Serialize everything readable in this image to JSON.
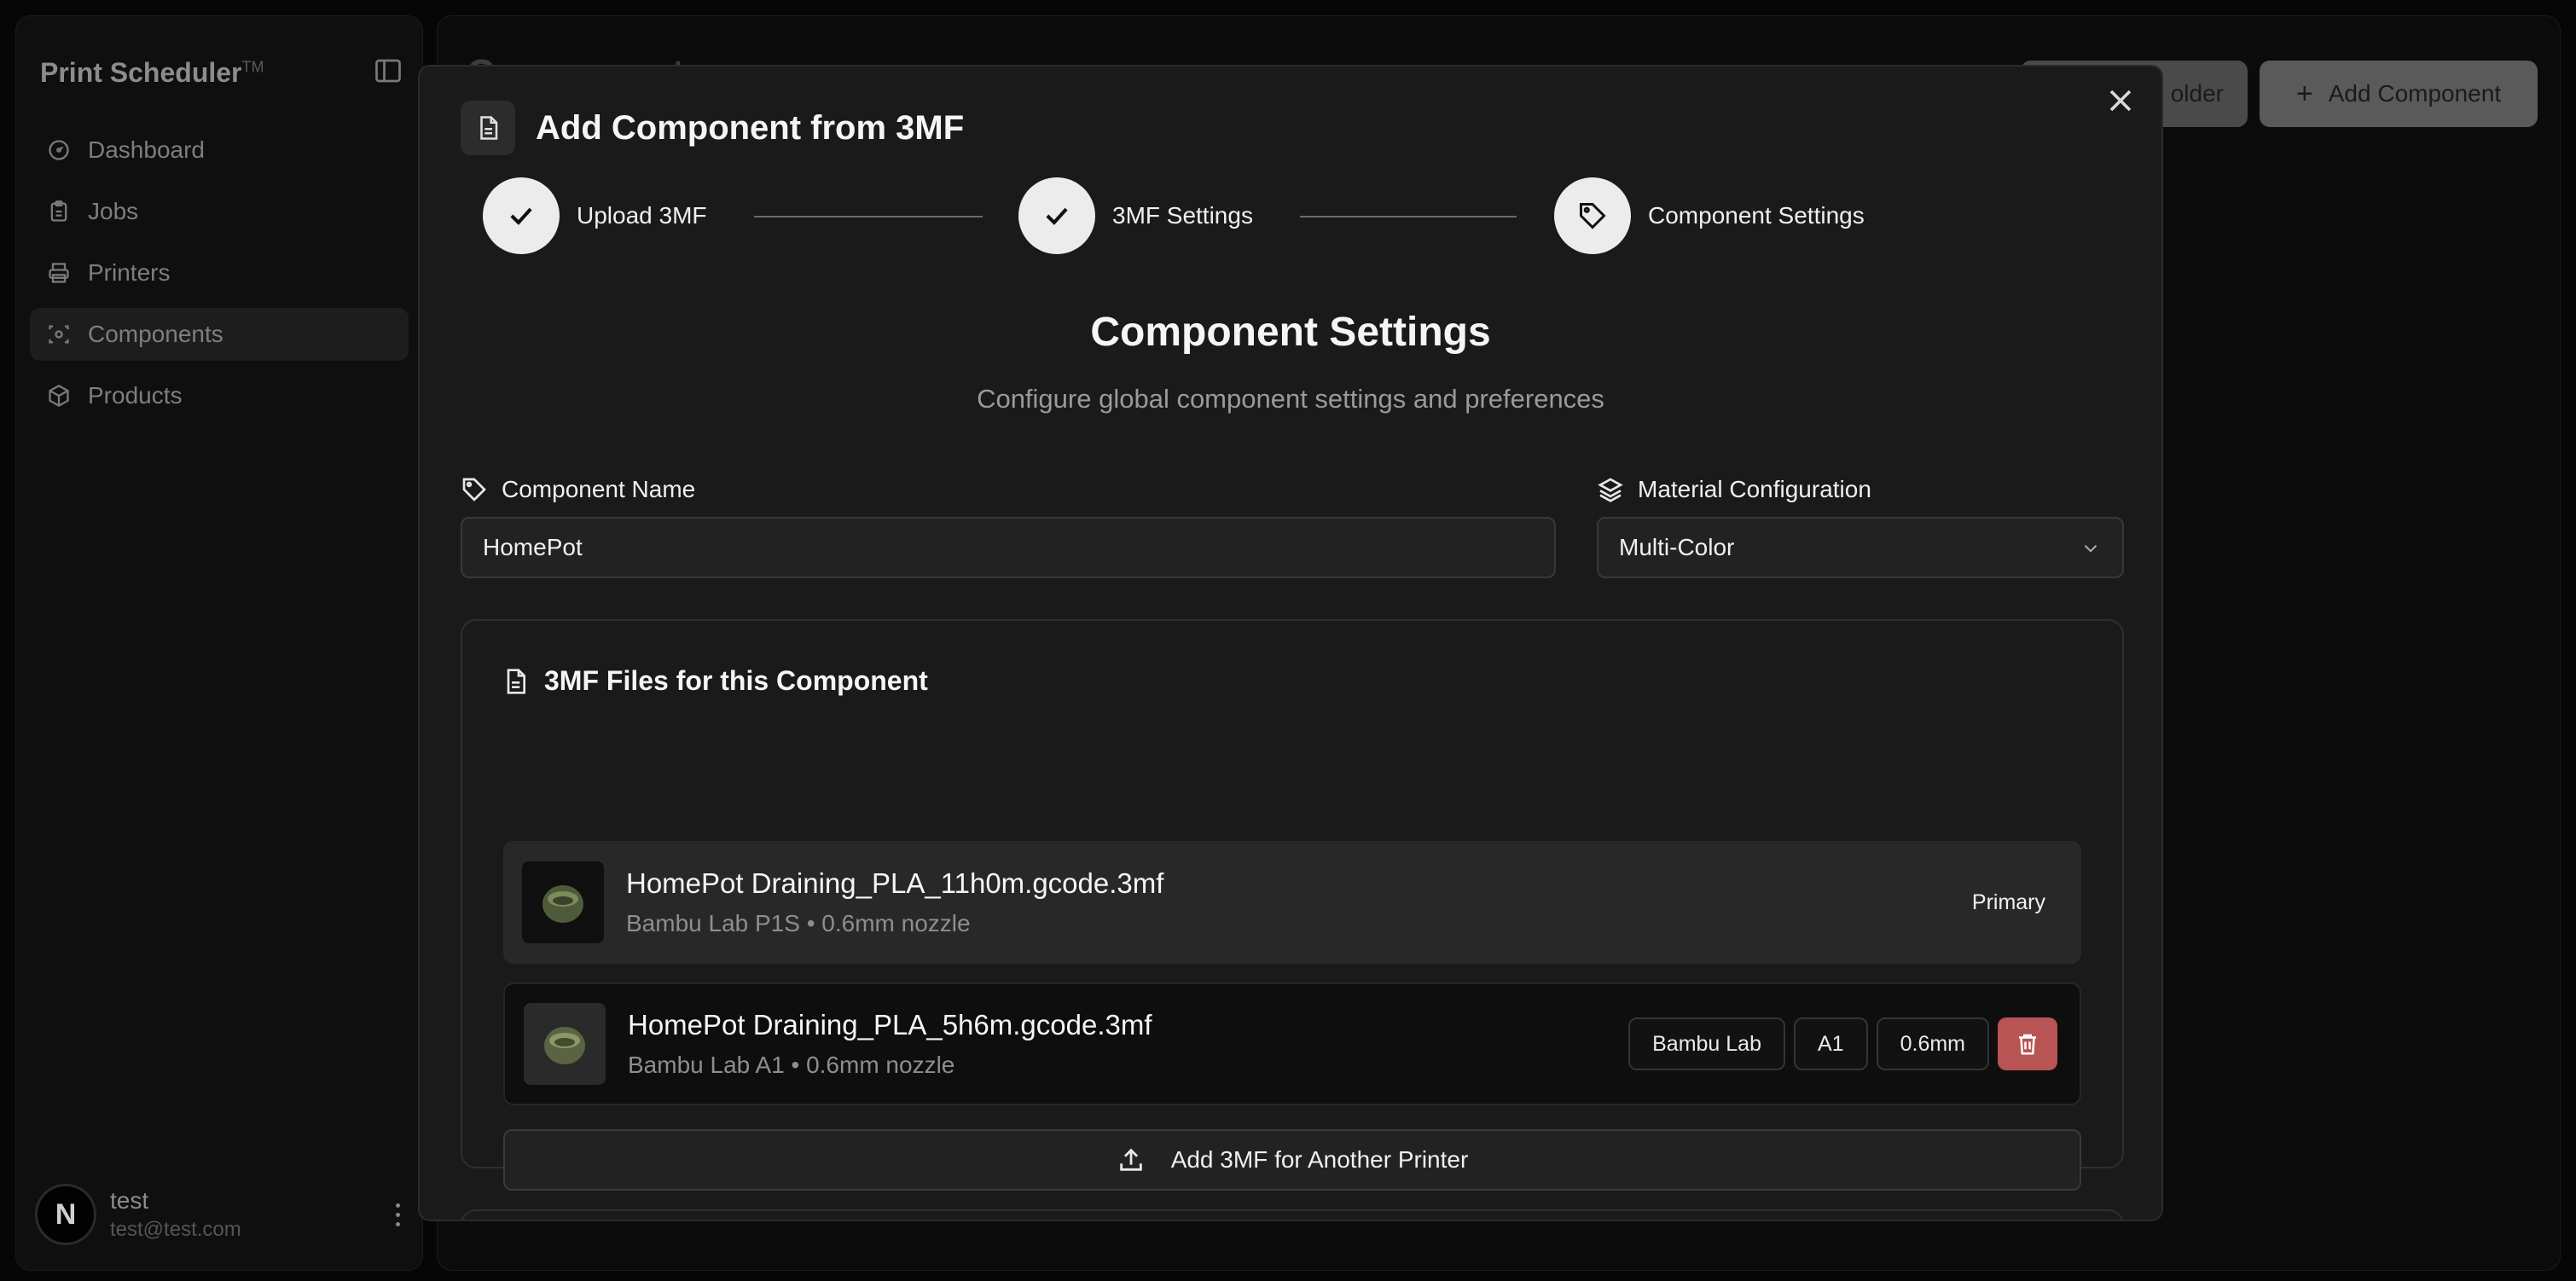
{
  "sidebar": {
    "brand": "Print Scheduler",
    "brand_mark": "TM",
    "nav": [
      {
        "label": "Dashboard",
        "icon": "dashboard-icon"
      },
      {
        "label": "Jobs",
        "icon": "clipboard-icon"
      },
      {
        "label": "Printers",
        "icon": "printer-icon"
      },
      {
        "label": "Components",
        "icon": "component-icon",
        "active": true
      },
      {
        "label": "Products",
        "icon": "package-icon"
      }
    ],
    "user": {
      "initial": "N",
      "name": "test",
      "email": "test@test.com"
    }
  },
  "main": {
    "title": "Components",
    "folder_button": "older",
    "add_button": "Add Component"
  },
  "modal": {
    "title": "Add Component from 3MF",
    "steps": [
      {
        "label": "Upload 3MF",
        "state": "done"
      },
      {
        "label": "3MF Settings",
        "state": "done"
      },
      {
        "label": "Component Settings",
        "state": "current"
      }
    ],
    "section_title": "Component Settings",
    "section_subtitle": "Configure global component settings and preferences",
    "component_name": {
      "label": "Component Name",
      "value": "HomePot"
    },
    "material": {
      "label": "Material Configuration",
      "value": "Multi-Color"
    },
    "files": {
      "heading": "3MF Files for this Component",
      "items": [
        {
          "name": "HomePot Draining_PLA_11h0m.gcode.3mf",
          "printer": "Bambu Lab P1S",
          "nozzle": "0.6mm nozzle",
          "badge": "Primary"
        },
        {
          "name": "HomePot Draining_PLA_5h6m.gcode.3mf",
          "printer": "Bambu Lab A1",
          "nozzle": "0.6mm nozzle",
          "tags": [
            "Bambu Lab",
            "A1",
            "0.6mm"
          ]
        }
      ],
      "add_button": "Add 3MF for Another Printer"
    }
  },
  "colors": {
    "delete": "#b85454",
    "step_circle": "#ececec"
  }
}
